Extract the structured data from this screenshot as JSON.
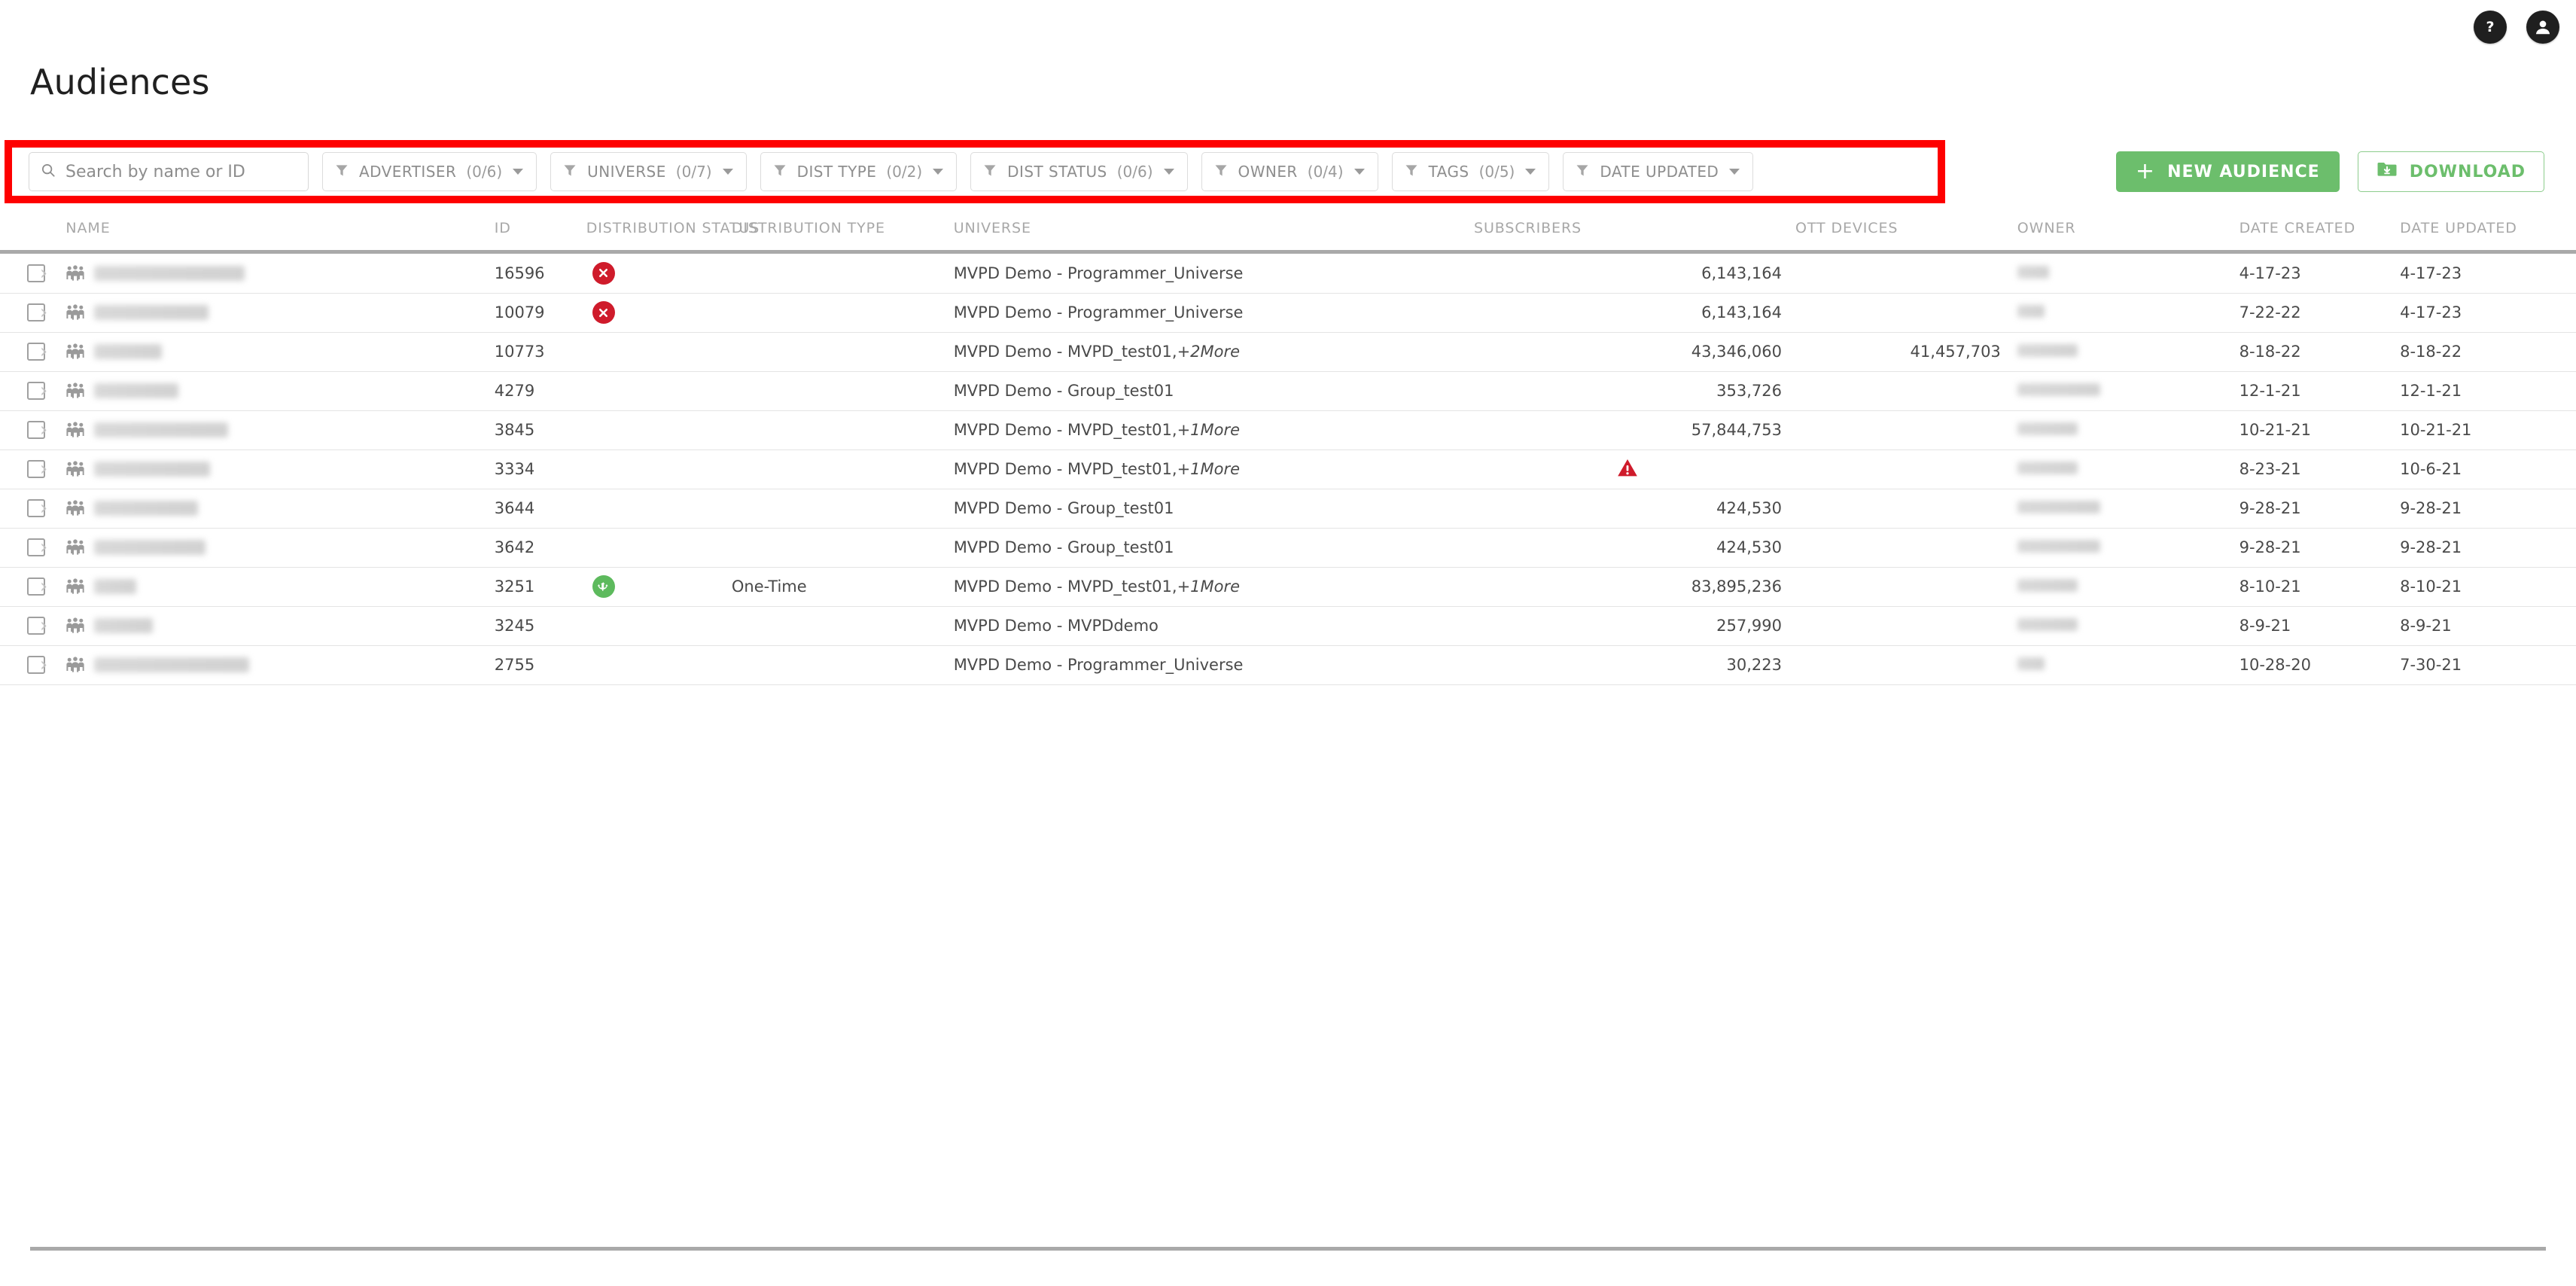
{
  "header": {
    "title": "Audiences",
    "help_icon": "help-icon",
    "account_icon": "account-icon"
  },
  "search": {
    "placeholder": "Search by name or ID",
    "value": "",
    "icon": "search-icon"
  },
  "filters": [
    {
      "label": "ADVERTISER",
      "count": "(0/6)",
      "icon": "funnel-icon",
      "has_count": true
    },
    {
      "label": "UNIVERSE",
      "count": "(0/7)",
      "icon": "funnel-icon",
      "has_count": true
    },
    {
      "label": "DIST TYPE",
      "count": "(0/2)",
      "icon": "funnel-icon",
      "has_count": true
    },
    {
      "label": "DIST STATUS",
      "count": "(0/6)",
      "icon": "funnel-icon",
      "has_count": true
    },
    {
      "label": "OWNER",
      "count": "(0/4)",
      "icon": "funnel-icon",
      "has_count": true
    },
    {
      "label": "TAGS",
      "count": "(0/5)",
      "icon": "funnel-icon",
      "has_count": true
    },
    {
      "label": "DATE UPDATED",
      "count": "",
      "icon": "funnel-icon",
      "has_count": false
    }
  ],
  "actions": {
    "new_audience_label": "NEW AUDIENCE",
    "new_audience_icon": "plus-icon",
    "download_label": "DOWNLOAD",
    "download_icon": "folder-download-icon"
  },
  "colors": {
    "accent_green": "#6cbe6c",
    "highlight_red": "#fe0000",
    "status_error": "#cf1b2b",
    "status_ok": "#5dba5d",
    "status_warning": "#cf1b2b",
    "title_text": "#202020",
    "muted_text": "#8e8e8e"
  },
  "table": {
    "columns": [
      "NAME",
      "ID",
      "DISTRIBUTION STATUS",
      "DISTRIBUTION TYPE",
      "UNIVERSE",
      "SUBSCRIBERS",
      "OTT DEVICES",
      "OWNER",
      "DATE CREATED",
      "DATE UPDATED"
    ],
    "rows": [
      {
        "name": "",
        "name_redacted_width": 200,
        "id": "16596",
        "dist_status": "error",
        "dist_type": "",
        "universe": "MVPD Demo - Programmer_Universe",
        "universe_more": "",
        "subscribers": "6,143,164",
        "ott_devices": "",
        "owner": "",
        "owner_redacted_width": 42,
        "date_created": "4-17-23",
        "date_updated": "4-17-23"
      },
      {
        "name": "",
        "name_redacted_width": 152,
        "id": "10079",
        "dist_status": "error",
        "dist_type": "",
        "universe": "MVPD Demo - Programmer_Universe",
        "universe_more": "",
        "subscribers": "6,143,164",
        "ott_devices": "",
        "owner": "",
        "owner_redacted_width": 36,
        "date_created": "7-22-22",
        "date_updated": "4-17-23"
      },
      {
        "name": "",
        "name_redacted_width": 90,
        "id": "10773",
        "dist_status": "",
        "dist_type": "",
        "universe": "MVPD Demo - MVPD_test01,",
        "universe_more": "+2More",
        "subscribers": "43,346,060",
        "ott_devices": "41,457,703",
        "owner": "",
        "owner_redacted_width": 80,
        "date_created": "8-18-22",
        "date_updated": "8-18-22"
      },
      {
        "name": "",
        "name_redacted_width": 112,
        "id": "4279",
        "dist_status": "",
        "dist_type": "",
        "universe": "MVPD Demo - Group_test01",
        "universe_more": "",
        "subscribers": "353,726",
        "ott_devices": "",
        "owner": "",
        "owner_redacted_width": 110,
        "date_created": "12-1-21",
        "date_updated": "12-1-21"
      },
      {
        "name": "",
        "name_redacted_width": 178,
        "id": "3845",
        "dist_status": "",
        "dist_type": "",
        "universe": "MVPD Demo - MVPD_test01,",
        "universe_more": "+1More",
        "subscribers": "57,844,753",
        "ott_devices": "",
        "owner": "",
        "owner_redacted_width": 80,
        "date_created": "10-21-21",
        "date_updated": "10-21-21"
      },
      {
        "name": "",
        "name_redacted_width": 154,
        "id": "3334",
        "dist_status": "warning",
        "dist_type": "",
        "universe": "MVPD Demo - MVPD_test01,",
        "universe_more": "+1More",
        "subscribers": "",
        "ott_devices": "",
        "owner": "",
        "owner_redacted_width": 80,
        "date_created": "8-23-21",
        "date_updated": "10-6-21"
      },
      {
        "name": "",
        "name_redacted_width": 138,
        "id": "3644",
        "dist_status": "",
        "dist_type": "",
        "universe": "MVPD Demo - Group_test01",
        "universe_more": "",
        "subscribers": "424,530",
        "ott_devices": "",
        "owner": "",
        "owner_redacted_width": 110,
        "date_created": "9-28-21",
        "date_updated": "9-28-21"
      },
      {
        "name": "",
        "name_redacted_width": 148,
        "id": "3642",
        "dist_status": "",
        "dist_type": "",
        "universe": "MVPD Demo - Group_test01",
        "universe_more": "",
        "subscribers": "424,530",
        "ott_devices": "",
        "owner": "",
        "owner_redacted_width": 110,
        "date_created": "9-28-21",
        "date_updated": "9-28-21"
      },
      {
        "name": "",
        "name_redacted_width": 56,
        "id": "3251",
        "dist_status": "ok",
        "dist_type": "One-Time",
        "universe": "MVPD Demo - MVPD_test01,",
        "universe_more": "+1More",
        "subscribers": "83,895,236",
        "ott_devices": "",
        "owner": "",
        "owner_redacted_width": 80,
        "date_created": "8-10-21",
        "date_updated": "8-10-21"
      },
      {
        "name": "",
        "name_redacted_width": 78,
        "id": "3245",
        "dist_status": "",
        "dist_type": "",
        "universe": "MVPD Demo - MVPDdemo",
        "universe_more": "",
        "subscribers": "257,990",
        "ott_devices": "",
        "owner": "",
        "owner_redacted_width": 80,
        "date_created": "8-9-21",
        "date_updated": "8-9-21"
      },
      {
        "name": "",
        "name_redacted_width": 206,
        "id": "2755",
        "dist_status": "",
        "dist_type": "",
        "universe": "MVPD Demo - Programmer_Universe",
        "universe_more": "",
        "subscribers": "30,223",
        "ott_devices": "",
        "owner": "",
        "owner_redacted_width": 36,
        "date_created": "10-28-20",
        "date_updated": "7-30-21"
      }
    ]
  }
}
